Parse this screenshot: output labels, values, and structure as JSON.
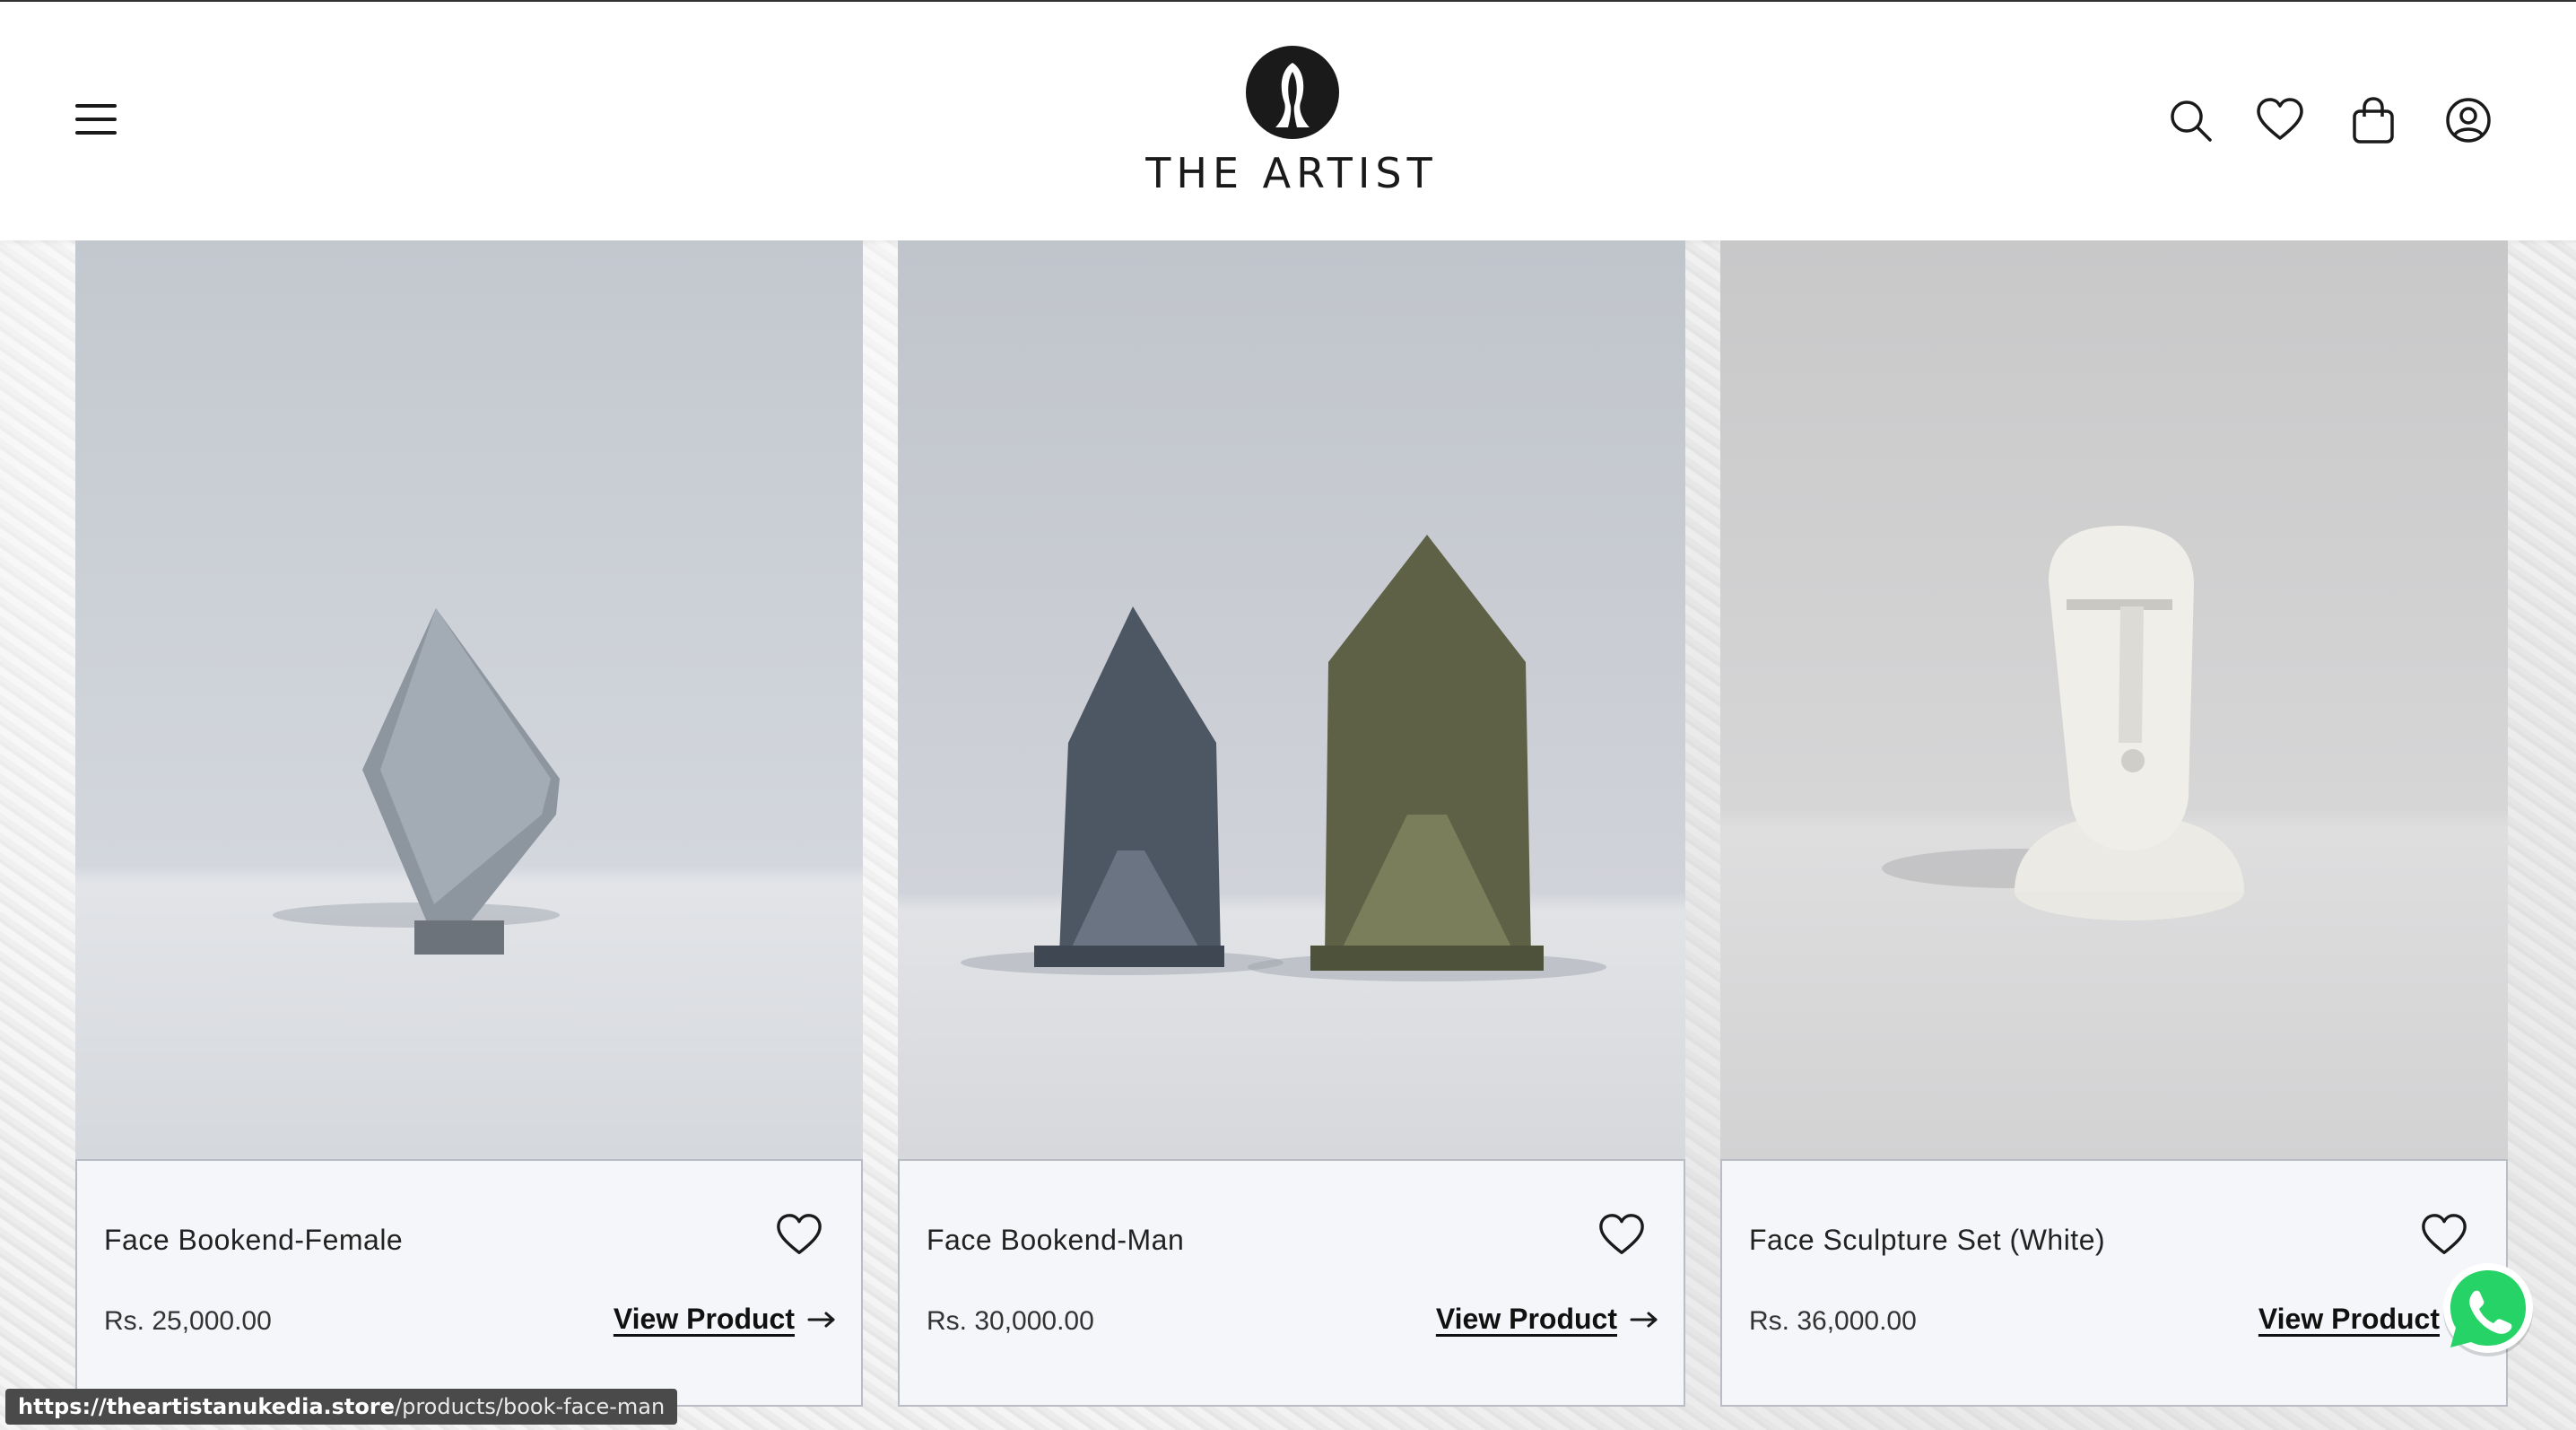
{
  "header": {
    "logo_text": "THE ARTIST",
    "menu_icon": "hamburger-menu-icon",
    "icons": [
      "search-icon",
      "heart-icon",
      "shopping-bag-icon",
      "user-account-icon"
    ]
  },
  "products": [
    {
      "title": "Face Bookend-Female",
      "price": "Rs. 25,000.00",
      "link_label": "View Product"
    },
    {
      "title": "Face Bookend-Man",
      "price": "Rs. 30,000.00",
      "link_label": "View Product"
    },
    {
      "title": "Face Sculpture Set (White)",
      "price": "Rs. 36,000.00",
      "link_label": "View Product"
    }
  ],
  "status_bar": {
    "host": "https://theartistanukedia.store",
    "path": "/products/book-face-man"
  },
  "colors": {
    "header_bg": "#ffffff",
    "card_info_bg": "#f5f6f9",
    "whatsapp_green": "#25d366",
    "text_dark": "#1a1a1a"
  }
}
